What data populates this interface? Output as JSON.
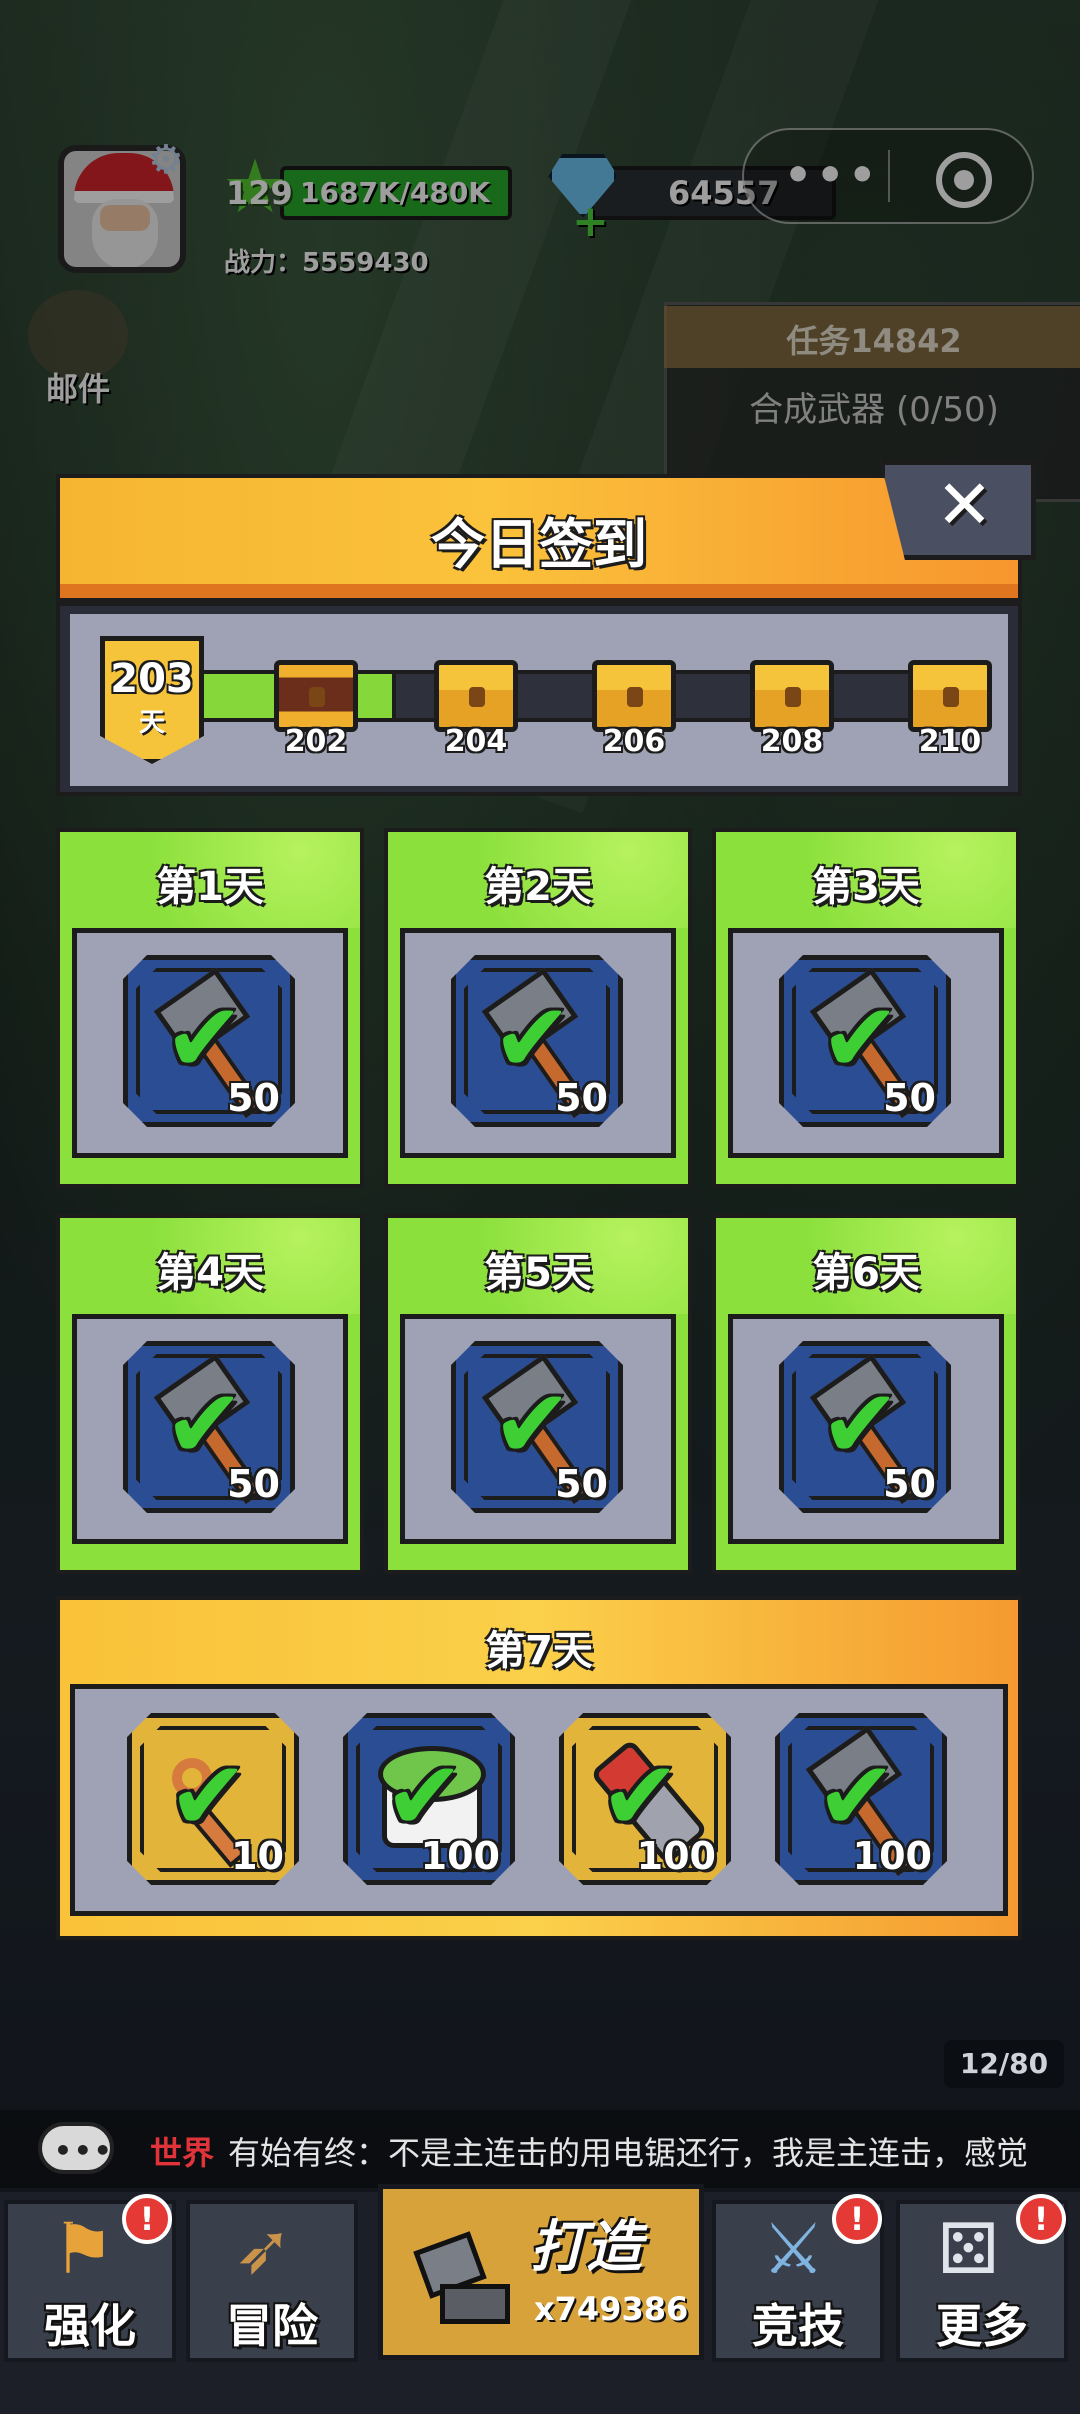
{
  "hud": {
    "level": "129",
    "exp": "1687K/480K",
    "power": "战力：5559430",
    "gems": "64557",
    "mail_label": "邮件"
  },
  "task": {
    "title": "任务14842",
    "desc": "合成武器 (0/50)"
  },
  "popup": {
    "title": "今日签到",
    "close": "✕",
    "current_day": "203",
    "day_unit": "天",
    "chests": [
      {
        "label": "202",
        "opened": true
      },
      {
        "label": "204",
        "opened": false
      },
      {
        "label": "206",
        "opened": false
      },
      {
        "label": "208",
        "opened": false
      },
      {
        "label": "210",
        "opened": false
      }
    ],
    "days": [
      {
        "label": "第1天",
        "qty": "50",
        "claimed": true
      },
      {
        "label": "第2天",
        "qty": "50",
        "claimed": true
      },
      {
        "label": "第3天",
        "qty": "50",
        "claimed": true
      },
      {
        "label": "第4天",
        "qty": "50",
        "claimed": true
      },
      {
        "label": "第5天",
        "qty": "50",
        "claimed": true
      },
      {
        "label": "第6天",
        "qty": "50",
        "claimed": true
      }
    ],
    "day7": {
      "label": "第7天",
      "items": [
        {
          "icon": "key-icon",
          "qty": "10",
          "frame": "gold"
        },
        {
          "icon": "drum-icon",
          "qty": "100",
          "frame": "blue"
        },
        {
          "icon": "battery-icon",
          "qty": "100",
          "frame": "gold"
        },
        {
          "icon": "hammer-icon",
          "qty": "100",
          "frame": "blue"
        }
      ]
    }
  },
  "chat": {
    "count": "12/80",
    "channel": "世界",
    "message": "有始有终：不是主连击的用电锯还行，我是主连击，感觉"
  },
  "nav": {
    "enhance": "强化",
    "adventure": "冒险",
    "forge": "打造",
    "forge_count": "x749386",
    "arena": "竞技",
    "more": "更多",
    "alert": "!"
  },
  "colors": {
    "accent_green": "#8be03c",
    "accent_gold": "#f9c238",
    "check_green": "#3ecf35",
    "alert_red": "#e53935"
  }
}
